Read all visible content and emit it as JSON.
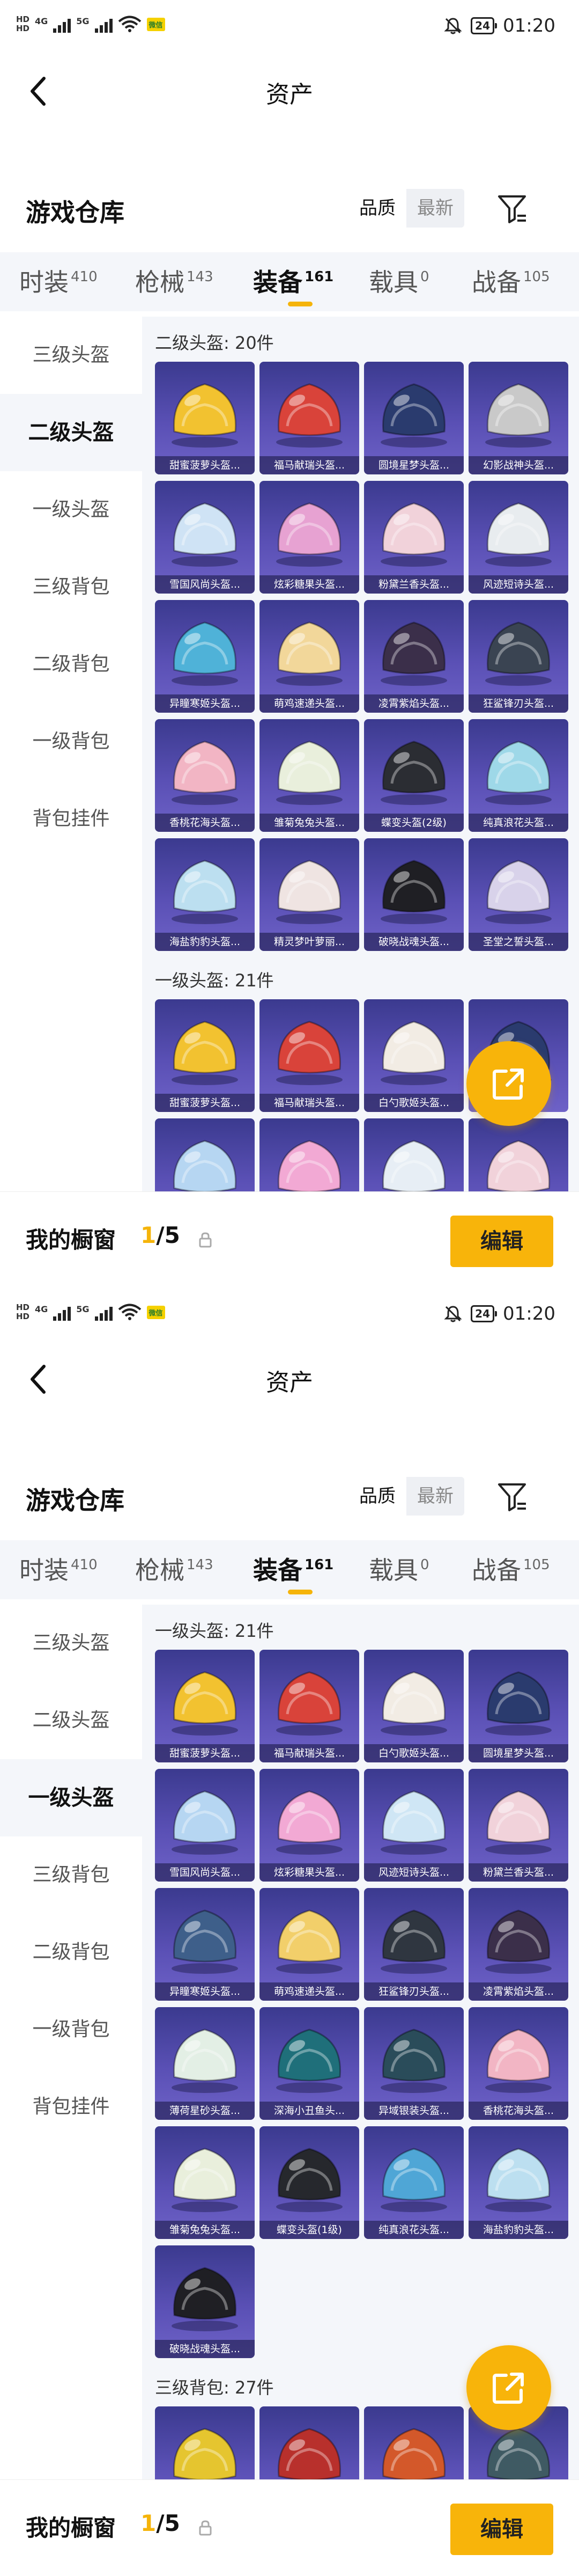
{
  "status_bar": {
    "sim_labels": [
      "HD",
      "HD"
    ],
    "net_type_1": "4G",
    "net_type_2": "5G",
    "badge": "微信",
    "battery": "24",
    "time": "01:20"
  },
  "nav": {
    "title": "资产"
  },
  "header": {
    "section_title": "游戏仓库",
    "sort_options": [
      "品质",
      "最新"
    ],
    "sort_selected": "品质"
  },
  "category_tabs": [
    {
      "label": "时装",
      "count": "410"
    },
    {
      "label": "枪械",
      "count": "143"
    },
    {
      "label": "装备",
      "count": "161"
    },
    {
      "label": "载具",
      "count": "0"
    },
    {
      "label": "战备",
      "count": "105"
    }
  ],
  "active_tab": "装备",
  "side_nav": [
    "三级头盔",
    "二级头盔",
    "一级头盔",
    "三级背包",
    "二级背包",
    "一级背包",
    "背包挂件"
  ],
  "screens": [
    {
      "active_side": "二级头盔",
      "groups": [
        {
          "title": "二级头盔: 20件",
          "items": [
            {
              "label": "甜蜜菠萝头盔...",
              "color": "#f2c230"
            },
            {
              "label": "福马献瑞头盔...",
              "color": "#d9433a"
            },
            {
              "label": "圆境星梦头盔...",
              "color": "#2a3b6e"
            },
            {
              "label": "幻影战神头盔...",
              "color": "#c9c9c9"
            },
            {
              "label": "雪国风尚头盔...",
              "color": "#cfe3f5"
            },
            {
              "label": "炫彩糖果头盔...",
              "color": "#e7a2d2"
            },
            {
              "label": "粉黛兰香头盔...",
              "color": "#f1d2da"
            },
            {
              "label": "风迹短诗头盔...",
              "color": "#e8ecef"
            },
            {
              "label": "异瞳寒姬头盔...",
              "color": "#4fb2d8"
            },
            {
              "label": "萌鸡速递头盔...",
              "color": "#f2d79a"
            },
            {
              "label": "凌霄紫焰头盔...",
              "color": "#3b2f4a"
            },
            {
              "label": "狂鲨锋刃头盔...",
              "color": "#3a4452"
            },
            {
              "label": "香桃花海头盔...",
              "color": "#f2b5c4"
            },
            {
              "label": "雏菊兔兔头盔...",
              "color": "#e9efdc"
            },
            {
              "label": "蝶变头盔(2级)",
              "color": "#2b2d33"
            },
            {
              "label": "纯真浪花头盔...",
              "color": "#9ed8e8"
            },
            {
              "label": "海盐豹豹头盔...",
              "color": "#bcdff0"
            },
            {
              "label": "精灵梦叶萝丽...",
              "color": "#efe4e2"
            },
            {
              "label": "破晓战魂头盔...",
              "color": "#1f1f24"
            },
            {
              "label": "圣堂之誓头盔...",
              "color": "#d8d2ea"
            }
          ]
        },
        {
          "title": "一级头盔: 21件",
          "items": [
            {
              "label": "甜蜜菠萝头盔...",
              "color": "#f2c230"
            },
            {
              "label": "福马献瑞头盔...",
              "color": "#d9433a"
            },
            {
              "label": "白勺歌姬头盔...",
              "color": "#f2ece4"
            },
            {
              "label": "",
              "color": "#2a3b6e"
            },
            {
              "label": "",
              "color": "#b6d6f2"
            },
            {
              "label": "",
              "color": "#f2a9d4"
            },
            {
              "label": "",
              "color": "#e7eef5"
            },
            {
              "label": "",
              "color": "#f1d2da"
            }
          ]
        }
      ]
    },
    {
      "active_side": "一级头盔",
      "groups": [
        {
          "title": "一级头盔: 21件",
          "items": [
            {
              "label": "甜蜜菠萝头盔...",
              "color": "#f2c230"
            },
            {
              "label": "福马献瑞头盔...",
              "color": "#d9433a"
            },
            {
              "label": "白勺歌姬头盔...",
              "color": "#f2ece4"
            },
            {
              "label": "圆境星梦头盔...",
              "color": "#2a3b6e"
            },
            {
              "label": "雪国风尚头盔...",
              "color": "#b6d6f2"
            },
            {
              "label": "炫彩糖果头盔...",
              "color": "#f2a9d4"
            },
            {
              "label": "风迹短诗头盔...",
              "color": "#cfe6f5"
            },
            {
              "label": "粉黛兰香头盔...",
              "color": "#f1d2da"
            },
            {
              "label": "异瞳寒姬头盔...",
              "color": "#3e5f8a"
            },
            {
              "label": "萌鸡速递头盔...",
              "color": "#f2cf6a"
            },
            {
              "label": "狂鲨锋刃头盔...",
              "color": "#2f3640"
            },
            {
              "label": "凌霄紫焰头盔...",
              "color": "#3b2f4a"
            },
            {
              "label": "薄荷星砂头盔...",
              "color": "#e3efe5"
            },
            {
              "label": "深海小丑鱼头...",
              "color": "#1f6f7a"
            },
            {
              "label": "异域银装头盔...",
              "color": "#2a4c5a"
            },
            {
              "label": "香桃花海头盔...",
              "color": "#f2b5c4"
            },
            {
              "label": "雏菊兔兔头盔...",
              "color": "#e9efdc"
            },
            {
              "label": "蝶变头盔(1级)",
              "color": "#26282d"
            },
            {
              "label": "纯真浪花头盔...",
              "color": "#4fa6d6"
            },
            {
              "label": "海盐豹豹头盔...",
              "color": "#bcdff0"
            },
            {
              "label": "破晓战魂头盔...",
              "color": "#1f1f24"
            }
          ]
        },
        {
          "title": "三级背包: 27件",
          "items": [
            {
              "label": "",
              "color": "#e5c52f"
            },
            {
              "label": "",
              "color": "#b8302c"
            },
            {
              "label": "",
              "color": "#d3582a"
            },
            {
              "label": "",
              "color": "#3f5a63"
            }
          ]
        }
      ]
    }
  ],
  "wardrobe": {
    "label": "我的橱窗",
    "current": "1",
    "total": "/5"
  },
  "edit_label": "编辑",
  "colors": {
    "accent": "#f8b40a",
    "card_top": "#3b3a8f",
    "card_bottom": "#6e62c7",
    "panel_bg": "#f4f6fa"
  },
  "icons": [
    "back-arrow-icon",
    "filter-icon",
    "share-out-icon",
    "lock-icon",
    "wifi-icon",
    "mute-icon",
    "battery-icon"
  ]
}
